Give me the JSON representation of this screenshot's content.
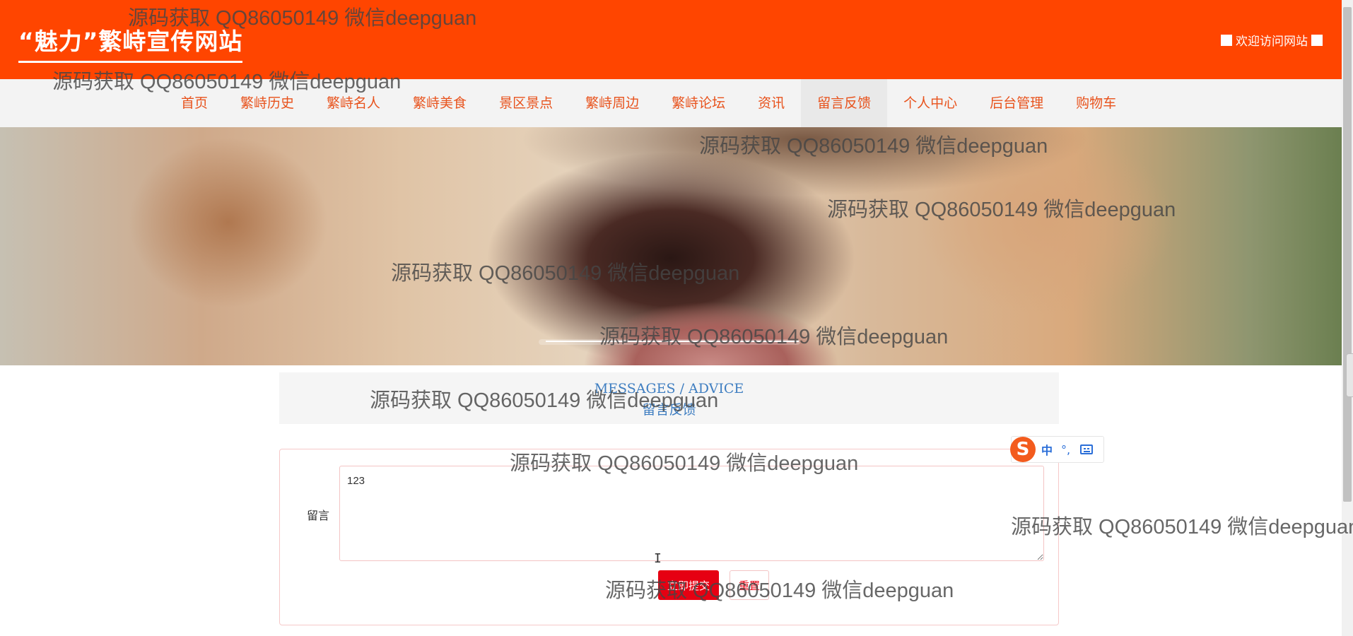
{
  "header": {
    "site_title": "“魅力”繁峙宣传网站",
    "welcome_text": "欢迎访问网站",
    "background_color": "#ff4500"
  },
  "nav": {
    "active_color": "#e8531d",
    "items": [
      {
        "label": "首页"
      },
      {
        "label": "繁峙历史"
      },
      {
        "label": "繁峙名人"
      },
      {
        "label": "繁峙美食"
      },
      {
        "label": "景区景点"
      },
      {
        "label": "繁峙周边"
      },
      {
        "label": "繁峙论坛"
      },
      {
        "label": "资讯"
      },
      {
        "label": "留言反馈"
      },
      {
        "label": "个人中心"
      },
      {
        "label": "后台管理"
      },
      {
        "label": "购物车"
      }
    ],
    "active_label": "留言反馈"
  },
  "section": {
    "title_en": "MESSAGES / ADVICE",
    "title_cn": "留言反馈"
  },
  "form": {
    "message_label": "留言",
    "message_value": "123",
    "submit_label": "立即提交",
    "reset_label": "重置"
  },
  "ime": {
    "logo": "S",
    "lang": "中",
    "punct": "°,"
  },
  "watermark_text": "源码获取 QQ86050149 微信deepguan",
  "colors": {
    "accent": "#ff4500",
    "submit": "#e60012",
    "heading_blue": "#3f7ec1"
  }
}
